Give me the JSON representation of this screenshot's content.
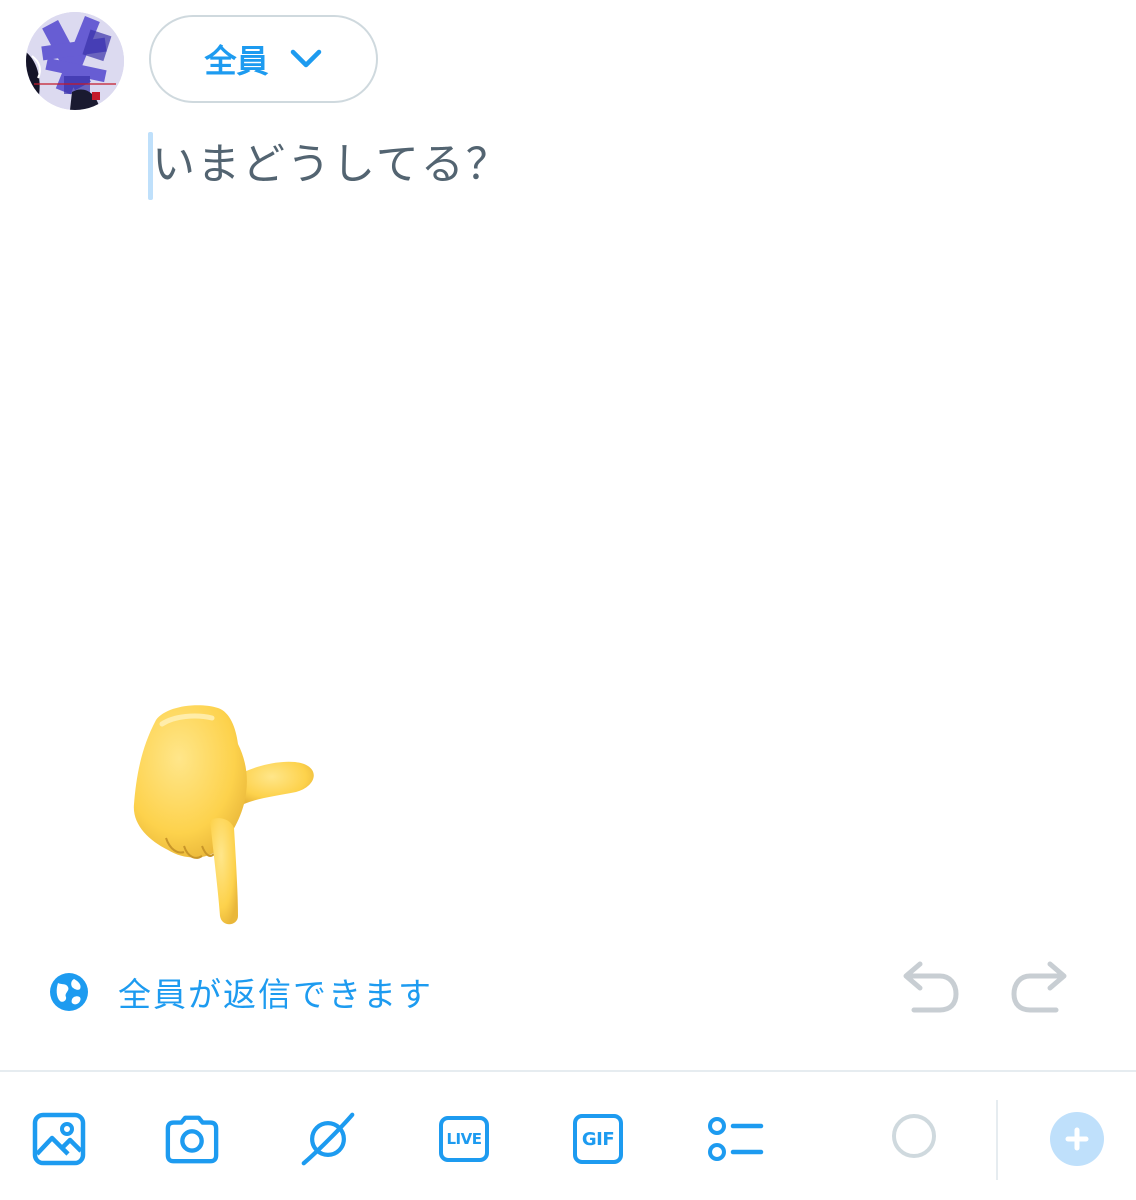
{
  "header": {
    "audience_label": "全員",
    "audience_chevron_icon": "chevron-down-icon"
  },
  "compose": {
    "placeholder": "いまどうしてる？"
  },
  "reply_setting": {
    "icon": "globe-icon",
    "label": "全員が返信できます"
  },
  "history": {
    "undo_icon": "undo-icon",
    "redo_icon": "redo-icon"
  },
  "toolbar": {
    "items": [
      {
        "icon": "image-icon"
      },
      {
        "icon": "camera-icon"
      },
      {
        "icon": "sparkle-icon"
      },
      {
        "icon": "live-icon",
        "text": "LIVE"
      },
      {
        "icon": "gif-icon",
        "text": "GIF"
      },
      {
        "icon": "poll-icon"
      }
    ],
    "char_counter_icon": "circle-progress-icon",
    "add_icon": "plus-icon"
  },
  "colors": {
    "accent": "#1d9bf0",
    "muted": "#536471",
    "disabled": "#cfd9de",
    "accent_light": "#bfe0fb"
  }
}
